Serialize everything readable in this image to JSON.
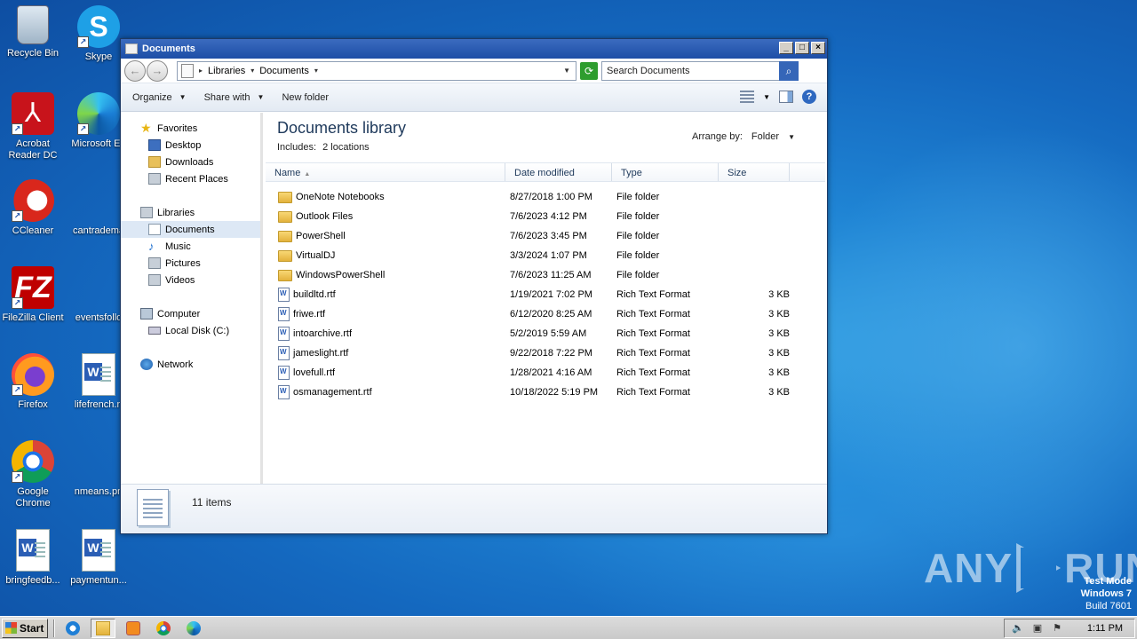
{
  "desktop": {
    "icons": [
      {
        "label": "Recycle Bin",
        "icon": "recycle-bin-icon"
      },
      {
        "label": "Skype",
        "icon": "skype-icon"
      },
      {
        "label": "Acrobat Reader DC",
        "icon": "acrobat-icon"
      },
      {
        "label": "Microsoft Ed",
        "icon": "edge-icon"
      },
      {
        "label": "CCleaner",
        "icon": "ccleaner-icon"
      },
      {
        "label": "cantradema",
        "icon": "word-doc-icon"
      },
      {
        "label": "FileZilla Client",
        "icon": "filezilla-icon"
      },
      {
        "label": "eventsfollo",
        "icon": "word-doc-icon"
      },
      {
        "label": "Firefox",
        "icon": "firefox-icon"
      },
      {
        "label": "lifefrench.rt",
        "icon": "word-doc-icon"
      },
      {
        "label": "Google Chrome",
        "icon": "chrome-icon"
      },
      {
        "label": "nmeans.pn",
        "icon": "image-file-icon"
      },
      {
        "label": "bringfeedb...",
        "icon": "word-doc-icon"
      },
      {
        "label": "paymentun...",
        "icon": "word-doc-icon"
      }
    ]
  },
  "window": {
    "title": "Documents",
    "controls": {
      "minimize": "_",
      "maximize": "□",
      "close": "×"
    },
    "address": {
      "crumbs": [
        "Libraries",
        "Documents"
      ],
      "search_placeholder": "Search Documents"
    },
    "toolbar": {
      "organize": "Organize",
      "share_with": "Share with",
      "new_folder": "New folder"
    },
    "nav": {
      "favorites": "Favorites",
      "desktop": "Desktop",
      "downloads": "Downloads",
      "recent_places": "Recent Places",
      "libraries": "Libraries",
      "documents": "Documents",
      "music": "Music",
      "pictures": "Pictures",
      "videos": "Videos",
      "computer": "Computer",
      "local_disk": "Local Disk (C:)",
      "network": "Network"
    },
    "library": {
      "title": "Documents library",
      "includes_label": "Includes:",
      "includes_value": "2 locations",
      "arrange_label": "Arrange by:",
      "arrange_value": "Folder"
    },
    "columns": {
      "name": "Name",
      "date": "Date modified",
      "type": "Type",
      "size": "Size"
    },
    "files": [
      {
        "name": "OneNote Notebooks",
        "date": "8/27/2018 1:00 PM",
        "type": "File folder",
        "size": "",
        "kind": "folder"
      },
      {
        "name": "Outlook Files",
        "date": "7/6/2023 4:12 PM",
        "type": "File folder",
        "size": "",
        "kind": "folder"
      },
      {
        "name": "PowerShell",
        "date": "7/6/2023 3:45 PM",
        "type": "File folder",
        "size": "",
        "kind": "folder"
      },
      {
        "name": "VirtualDJ",
        "date": "3/3/2024 1:07 PM",
        "type": "File folder",
        "size": "",
        "kind": "folder"
      },
      {
        "name": "WindowsPowerShell",
        "date": "7/6/2023 11:25 AM",
        "type": "File folder",
        "size": "",
        "kind": "folder"
      },
      {
        "name": "buildltd.rtf",
        "date": "1/19/2021 7:02 PM",
        "type": "Rich Text Format",
        "size": "3 KB",
        "kind": "rtf"
      },
      {
        "name": "friwe.rtf",
        "date": "6/12/2020 8:25 AM",
        "type": "Rich Text Format",
        "size": "3 KB",
        "kind": "rtf"
      },
      {
        "name": "intoarchive.rtf",
        "date": "5/2/2019 5:59 AM",
        "type": "Rich Text Format",
        "size": "3 KB",
        "kind": "rtf"
      },
      {
        "name": "jameslight.rtf",
        "date": "9/22/2018 7:22 PM",
        "type": "Rich Text Format",
        "size": "3 KB",
        "kind": "rtf"
      },
      {
        "name": "lovefull.rtf",
        "date": "1/28/2021 4:16 AM",
        "type": "Rich Text Format",
        "size": "3 KB",
        "kind": "rtf"
      },
      {
        "name": "osmanagement.rtf",
        "date": "10/18/2022 5:19 PM",
        "type": "Rich Text Format",
        "size": "3 KB",
        "kind": "rtf"
      }
    ],
    "status": {
      "count": "11 items"
    }
  },
  "watermark": {
    "left": "ANY",
    "right": "RUN"
  },
  "testmode": {
    "line1": "Test Mode",
    "line2": "Windows 7",
    "line3": "Build 7601"
  },
  "taskbar": {
    "start": "Start",
    "clock": "1:11 PM"
  }
}
